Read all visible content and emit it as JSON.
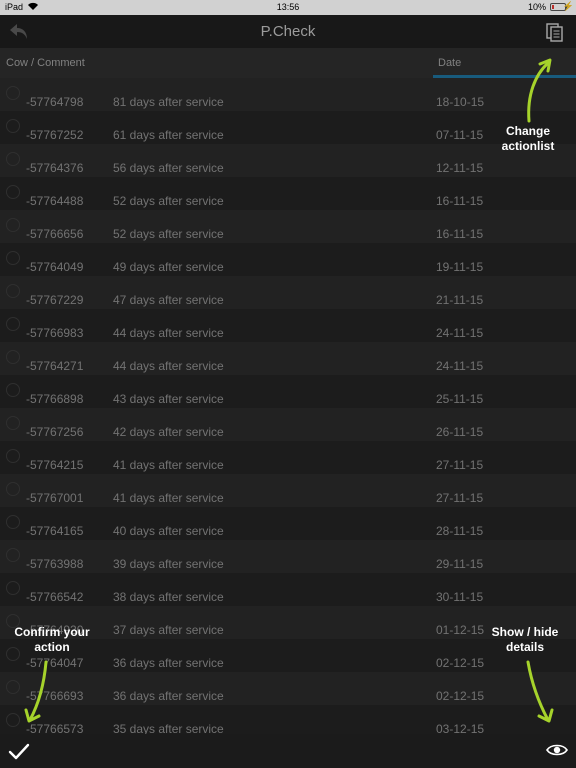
{
  "status": {
    "carrier": "iPad",
    "time": "13:56",
    "battery": "10%"
  },
  "nav": {
    "title": "P.Check"
  },
  "header": {
    "cow_comment": "Cow / Comment",
    "date": "Date"
  },
  "rows": [
    {
      "cow": "-57764798",
      "days": "81  days after service",
      "date": "18-10-15"
    },
    {
      "cow": "-57767252",
      "days": "61  days after service",
      "date": "07-11-15"
    },
    {
      "cow": "-57764376",
      "days": "56  days after service",
      "date": "12-11-15"
    },
    {
      "cow": "-57764488",
      "days": "52  days after service",
      "date": "16-11-15"
    },
    {
      "cow": "-57766656",
      "days": "52  days after service",
      "date": "16-11-15"
    },
    {
      "cow": "-57764049",
      "days": "49  days after service",
      "date": "19-11-15"
    },
    {
      "cow": "-57767229",
      "days": "47  days after service",
      "date": "21-11-15"
    },
    {
      "cow": "-57766983",
      "days": "44  days after service",
      "date": "24-11-15"
    },
    {
      "cow": "-57764271",
      "days": "44  days after service",
      "date": "24-11-15"
    },
    {
      "cow": "-57766898",
      "days": "43  days after service",
      "date": "25-11-15"
    },
    {
      "cow": "-57767256",
      "days": "42  days after service",
      "date": "26-11-15"
    },
    {
      "cow": "-57764215",
      "days": "41  days after service",
      "date": "27-11-15"
    },
    {
      "cow": "-57767001",
      "days": "41  days after service",
      "date": "27-11-15"
    },
    {
      "cow": "-57764165",
      "days": "40  days after service",
      "date": "28-11-15"
    },
    {
      "cow": "-57763988",
      "days": "39  days after service",
      "date": "29-11-15"
    },
    {
      "cow": "-57766542",
      "days": "38  days after service",
      "date": "30-11-15"
    },
    {
      "cow": "-57764920",
      "days": "37  days after service",
      "date": "01-12-15"
    },
    {
      "cow": "-57764047",
      "days": "36  days after service",
      "date": "02-12-15"
    },
    {
      "cow": "-57766693",
      "days": "36  days after service",
      "date": "02-12-15"
    },
    {
      "cow": "-57766573",
      "days": "35  days after service",
      "date": "03-12-15"
    }
  ],
  "callouts": {
    "change_actionlist_line1": "Change",
    "change_actionlist_line2": "actionlist",
    "confirm_line1": "Confirm your",
    "confirm_line2": "action",
    "show_hide_line1": "Show / hide",
    "show_hide_line2": "details"
  },
  "colors": {
    "arrow": "#a6d32b",
    "accent": "#1e6f99"
  },
  "icons": [
    "back-icon",
    "actionlist-icon",
    "check-icon",
    "eye-icon"
  ]
}
